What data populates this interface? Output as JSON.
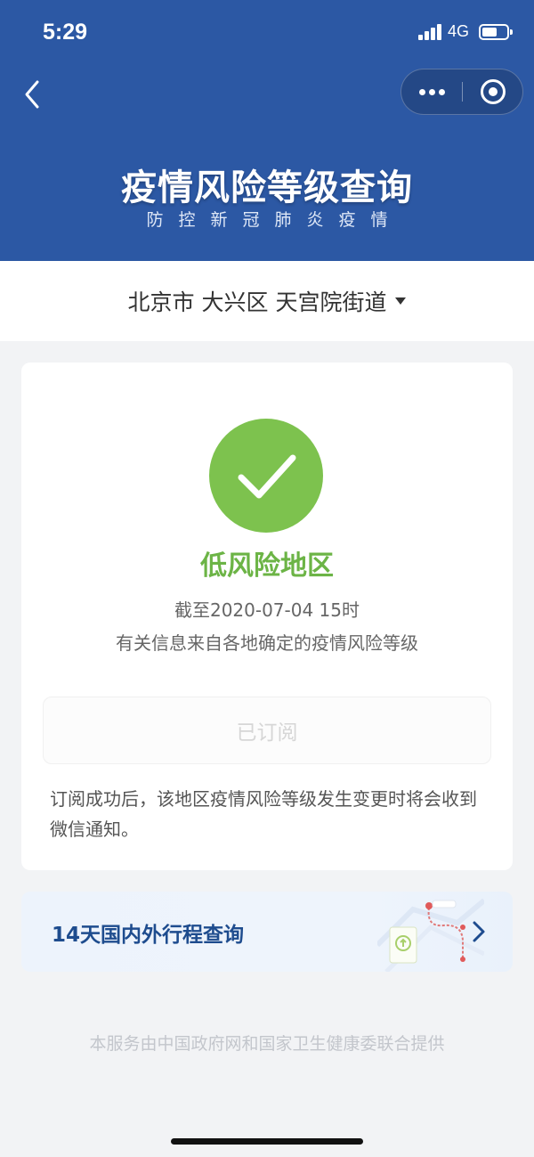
{
  "status_bar": {
    "time": "5:29",
    "network": "4G"
  },
  "header": {
    "title": "疫情风险等级查询",
    "subtitle": "防控新冠肺炎疫情",
    "background_color": "#2c58a4"
  },
  "nav": {
    "back_icon": "chevron-left-icon",
    "more_icon": "more-dots-icon",
    "close_icon": "target-circle-icon"
  },
  "location": {
    "text": "北京市 大兴区 天宫院街道",
    "dropdown_icon": "caret-down-icon"
  },
  "result": {
    "status_icon": "check-icon",
    "status_color": "#7dc24e",
    "risk_level": "低风险地区",
    "as_of": "截至2020-07-04 15时",
    "source_note": "有关信息来自各地确定的疫情风险等级",
    "subscribe_label": "已订阅",
    "subscribe_note": "订阅成功后，该地区疫情风险等级发生变更时将会收到微信通知。"
  },
  "travel": {
    "label": "14天国内外行程查询",
    "arrow_icon": "chevron-right-icon"
  },
  "footer": {
    "text": "本服务由中国政府网和国家卫生健康委联合提供"
  }
}
